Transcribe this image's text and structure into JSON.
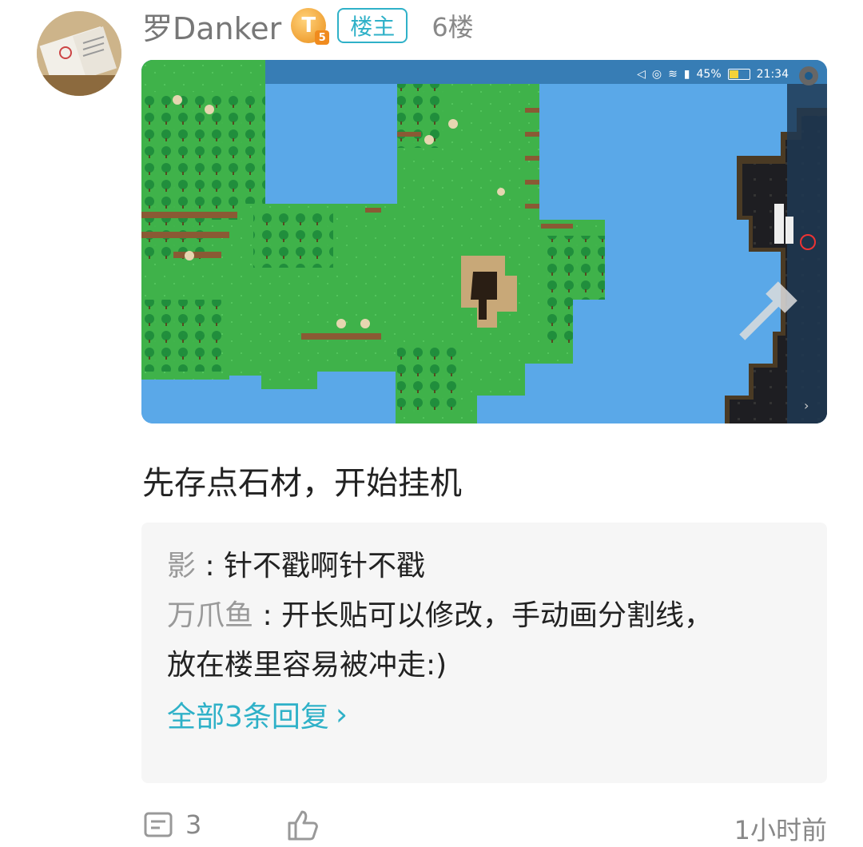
{
  "post": {
    "username": "罗Danker",
    "level_badge": "T",
    "level_sub": "5",
    "op_tag": "楼主",
    "floor": "6楼",
    "text": "先存点石材，开始挂机"
  },
  "screenshot": {
    "status": {
      "battery": "45%",
      "time": "21:34"
    }
  },
  "replies": [
    {
      "who": "影",
      "text": " : 针不戳啊针不戳"
    },
    {
      "who": "万爪鱼",
      "text": " : 开长贴可以修改，手动画分割线，",
      "text2": "放在楼里容易被冲走:)"
    }
  ],
  "reply_more": "全部3条回复",
  "footer": {
    "comment_count": "3",
    "time": "1小时前"
  },
  "colors": {
    "accent": "#2fb1c8",
    "water": "#5aa8e8",
    "grass": "#3fb24a"
  }
}
